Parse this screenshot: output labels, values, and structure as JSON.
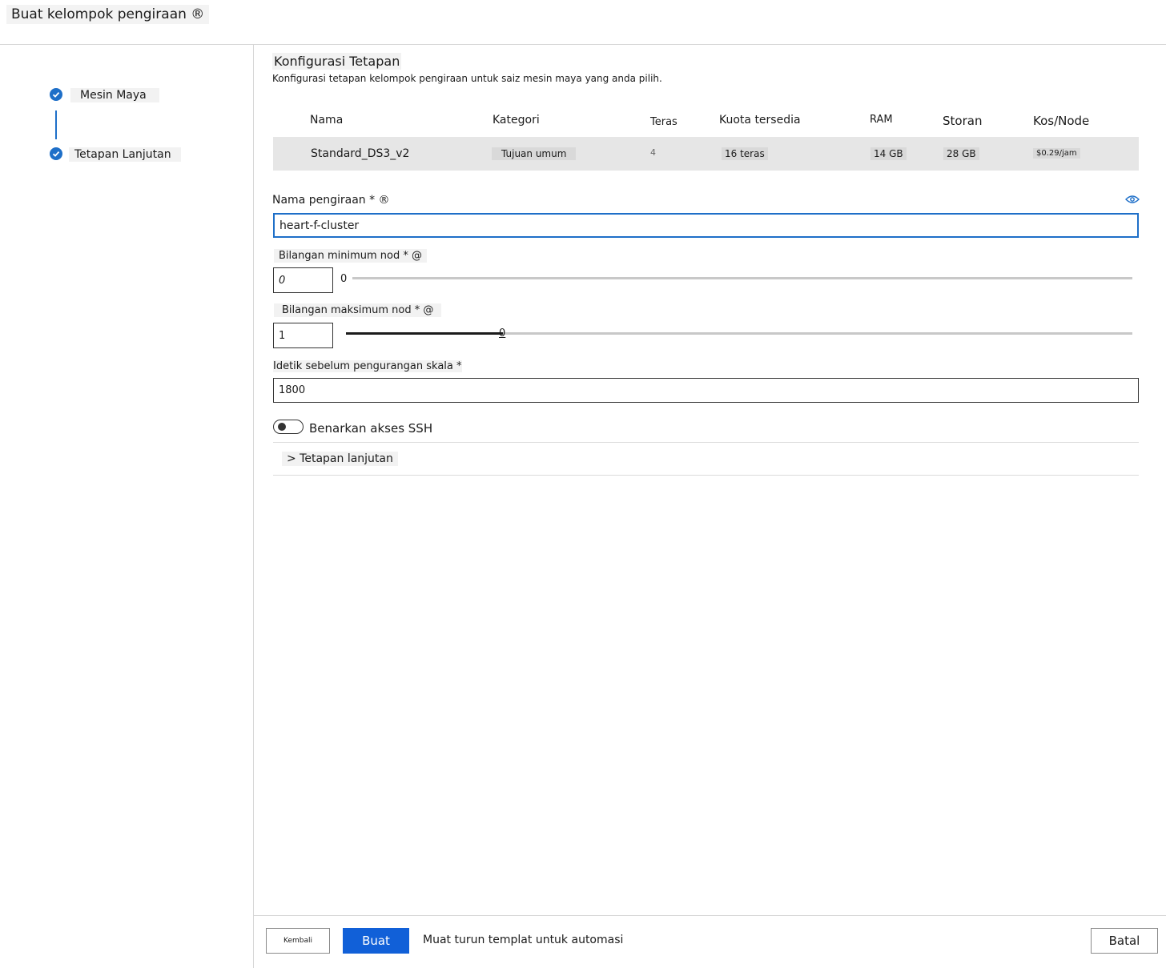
{
  "header": {
    "title": "Buat kelompok pengiraan ®"
  },
  "steps": [
    {
      "label": "Mesin Maya"
    },
    {
      "label": "Tetapan Lanjutan"
    }
  ],
  "main": {
    "title": "Konfigurasi Tetapan",
    "subtitle": "Konfigurasi tetapan kelompok pengiraan untuk saiz mesin maya yang anda pilih."
  },
  "vm_table": {
    "headers": [
      "Nama",
      "Kategori",
      "Teras",
      "Kuota tersedia",
      "RAM",
      "Storan",
      "Kos/Node"
    ],
    "row": [
      "Standard_DS3_v2",
      "Tujuan umum",
      "4",
      "16 teras",
      "14 GB",
      "28 GB",
      "$0.29/jam"
    ]
  },
  "compute_name": {
    "label": "Nama pengiraan * ®",
    "value": "heart-f-cluster"
  },
  "min_nodes": {
    "label": "Bilangan minimum nod * @",
    "value": "0",
    "slider_value": "0",
    "slider_fraction": 0.0
  },
  "max_nodes": {
    "label": "Bilangan maksimum nod * @",
    "value": "1",
    "slider_value": "0",
    "slider_fraction": 0.2
  },
  "idle_seconds": {
    "label": "Idetik sebelum pengurangan skala *",
    "value": "1800"
  },
  "ssh": {
    "label": "Benarkan akses SSH",
    "enabled": false
  },
  "advanced": {
    "label": "> Tetapan lanjutan"
  },
  "footer": {
    "back_label": "Kembali",
    "create_label": "Buat",
    "download_label": "Muat turun templat untuk automasi",
    "cancel_label": "Batal"
  },
  "colors": {
    "accent": "#1e6fc8",
    "primary_button": "#1160d8"
  },
  "icons": [
    "check-icon",
    "eye-icon"
  ]
}
